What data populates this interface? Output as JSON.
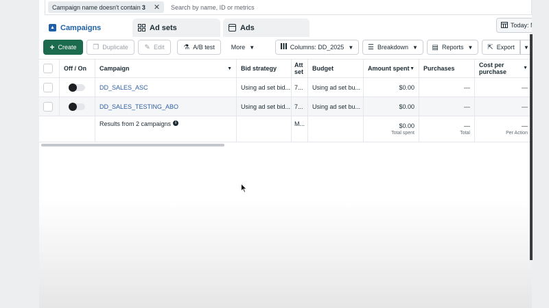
{
  "filter": {
    "chip_label": "Campaign name doesn't contain",
    "chip_value": "3",
    "search_placeholder": "Search by name, ID or metrics"
  },
  "tabs": [
    {
      "label": "Campaigns",
      "icon": "campaigns-icon",
      "active": true
    },
    {
      "label": "Ad sets",
      "icon": "adsets-grid-icon",
      "active": false
    },
    {
      "label": "Ads",
      "icon": "ads-icon",
      "active": false
    }
  ],
  "date_button": {
    "label": "Today: M",
    "icon": "calendar-icon"
  },
  "toolbar": {
    "create": "Create",
    "duplicate": "Duplicate",
    "edit": "Edit",
    "ab_test": "A/B test",
    "more": "More",
    "columns": "Columns: DD_2025",
    "breakdown": "Breakdown",
    "reports": "Reports",
    "export": "Export"
  },
  "table": {
    "headers": {
      "off_on": "Off / On",
      "campaign": "Campaign",
      "bid_strategy": "Bid strategy",
      "attribution": "Att set",
      "budget": "Budget",
      "amount_spent": "Amount spent",
      "purchases": "Purchases",
      "cost_per_purchase": "Cost per purchase"
    },
    "rows": [
      {
        "campaign": "DD_SALES_ASC",
        "bid_strategy": "Using ad set bid...",
        "attribution": "7...",
        "budget": "Using ad set bu...",
        "amount_spent": "$0.00",
        "purchases": "—",
        "cost_per_purchase": "—"
      },
      {
        "campaign": "DD_SALES_TESTING_ABO",
        "bid_strategy": "Using ad set bid...",
        "attribution": "7...",
        "budget": "Using ad set bu...",
        "amount_spent": "$0.00",
        "purchases": "—",
        "cost_per_purchase": "—"
      }
    ],
    "summary": {
      "label": "Results from 2 campaigns",
      "attribution": "M...",
      "amount_spent": "$0.00",
      "amount_spent_sub": "Total spent",
      "purchases": "—",
      "purchases_sub": "Total",
      "cost_per_purchase": "—",
      "cost_per_purchase_sub": "Per Action"
    }
  },
  "colors": {
    "accent": "#1f5fa8",
    "create_button": "#1d6b4e",
    "link": "#2d5fa3"
  }
}
